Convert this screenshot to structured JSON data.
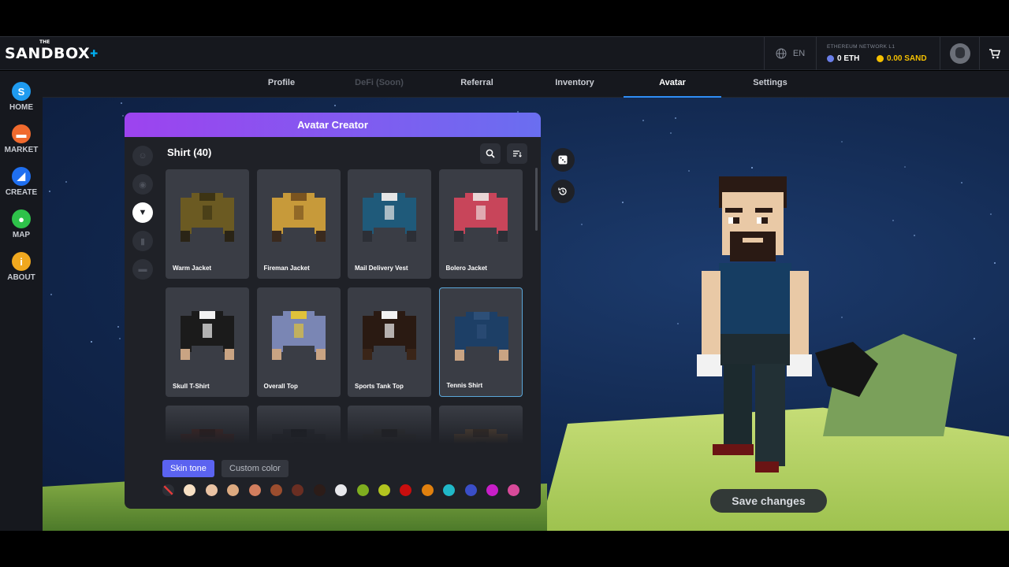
{
  "brand": {
    "logo_text": "SANDBOX",
    "logo_prefix": "THE"
  },
  "topbar": {
    "language": "EN",
    "network_label": "ETHEREUM NETWORK L1",
    "eth_balance": "0 ETH",
    "sand_balance": "0.00 SAND"
  },
  "sidebar": {
    "items": [
      {
        "label": "HOME",
        "icon": "sandbox-s-icon",
        "glyph": "S",
        "color": "#1f9bf0"
      },
      {
        "label": "MARKET",
        "icon": "market-icon",
        "glyph": "▬",
        "color": "#f06a2e"
      },
      {
        "label": "CREATE",
        "icon": "create-icon",
        "glyph": "◢",
        "color": "#1f6ff0"
      },
      {
        "label": "MAP",
        "icon": "map-pin-icon",
        "glyph": "●",
        "color": "#2ec24a"
      },
      {
        "label": "ABOUT",
        "icon": "info-icon",
        "glyph": "i",
        "color": "#f0a81f"
      }
    ]
  },
  "nav": {
    "tabs": [
      {
        "label": "Profile",
        "state": "normal"
      },
      {
        "label": "DeFi (Soon)",
        "state": "disabled"
      },
      {
        "label": "Referral",
        "state": "normal"
      },
      {
        "label": "Inventory",
        "state": "normal"
      },
      {
        "label": "Avatar",
        "state": "active"
      },
      {
        "label": "Settings",
        "state": "normal"
      }
    ]
  },
  "creator": {
    "title": "Avatar Creator",
    "category_title": "Shirt (40)",
    "categories": [
      "body-icon",
      "head-icon",
      "shirt-icon",
      "pants-icon",
      "shoes-icon"
    ],
    "active_category": 2,
    "items": [
      {
        "name": "Warm Jacket",
        "colors": [
          "#6b5a22",
          "#3d3414",
          "#2a2416"
        ]
      },
      {
        "name": "Fireman Jacket",
        "colors": [
          "#c79a3a",
          "#7a5420",
          "#3a2a1e"
        ]
      },
      {
        "name": "Mail Delivery Vest",
        "colors": [
          "#1f5a7a",
          "#e6e6e6",
          "#2c2f36"
        ]
      },
      {
        "name": "Bolero Jacket",
        "colors": [
          "#c8455a",
          "#e9d6d6",
          "#2c2f36"
        ]
      },
      {
        "name": "Skull T-Shirt",
        "colors": [
          "#1b1b1b",
          "#f2f2f2",
          "#c9a483"
        ]
      },
      {
        "name": "Overall Top",
        "colors": [
          "#7a86b4",
          "#e0c23a",
          "#c9a483"
        ]
      },
      {
        "name": "Sports Tank Top",
        "colors": [
          "#2a1a12",
          "#f2f2f2",
          "#3a2518"
        ]
      },
      {
        "name": "Tennis Shirt",
        "colors": [
          "#1d3f66",
          "#2d4f77",
          "#c9a483"
        ]
      },
      {
        "name": "",
        "colors": [
          "#5a2a22",
          "#3a1a14",
          "#2a2a2a"
        ]
      },
      {
        "name": "",
        "colors": [
          "#2a2d35",
          "#1a1c22",
          "#2a2a2a"
        ]
      },
      {
        "name": "",
        "colors": [
          "#3a3a3a",
          "#222",
          "#2a2a2a"
        ]
      },
      {
        "name": "",
        "colors": [
          "#7a5a3a",
          "#4a3422",
          "#2a2a2a"
        ]
      }
    ],
    "selected_item": 7,
    "tone_tabs": [
      {
        "label": "Skin tone",
        "active": true
      },
      {
        "label": "Custom color",
        "active": false
      }
    ],
    "swatches": [
      "none",
      "#f7e0c4",
      "#eac3a4",
      "#ddaa80",
      "#d27e5e",
      "#9b4d2e",
      "#6a2e22",
      "#2c1c18",
      "#e8e8ec",
      "#7fae1f",
      "#b2c41f",
      "#c90e0e",
      "#e0800e",
      "#20b8c8",
      "#3a4ec8",
      "#c81ec8",
      "#d84a9a"
    ]
  },
  "scene": {
    "save_label": "Save changes"
  }
}
